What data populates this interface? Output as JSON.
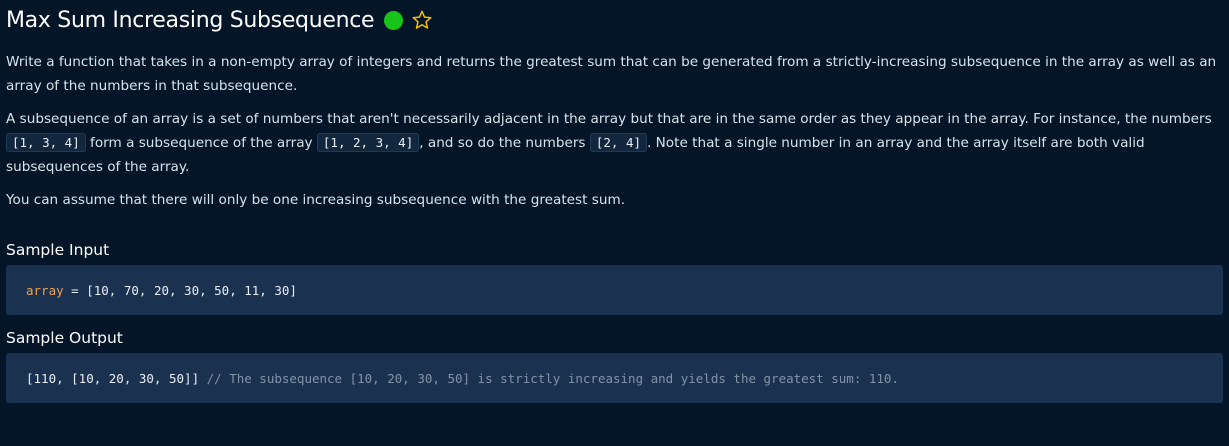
{
  "header": {
    "title": "Max Sum Increasing Subsequence",
    "status_color": "#18c418",
    "star_icon": "star-outline-icon",
    "star_color": "#f2c200"
  },
  "description": {
    "p1": "Write a function that takes in a non-empty array of integers and returns the greatest sum that can be generated from a strictly-increasing subsequence in the array as well as an array of the numbers in that subsequence.",
    "p2_a": "A subsequence of an array is a set of numbers that aren't necessarily adjacent in the array but that are in the same order as they appear in the array. For instance, the numbers ",
    "p2_code1": "[1, 3, 4]",
    "p2_b": " form a subsequence of the array ",
    "p2_code2": "[1, 2, 3, 4]",
    "p2_c": ", and so do the numbers ",
    "p2_code3": "[2, 4]",
    "p2_d": ". Note that a single number in an array and the array itself are both valid subsequences of the array.",
    "p3": "You can assume that there will only be one increasing subsequence with the greatest sum."
  },
  "sample_input": {
    "heading": "Sample Input",
    "var_name": "array",
    "rest": " = [10, 70, 20, 30, 50, 11, 30]"
  },
  "sample_output": {
    "heading": "Sample Output",
    "value": "[110, [10, 20, 30, 50]]",
    "comment": " // The subsequence [10, 20, 30, 50] is strictly increasing and yields the greatest sum: 110."
  }
}
